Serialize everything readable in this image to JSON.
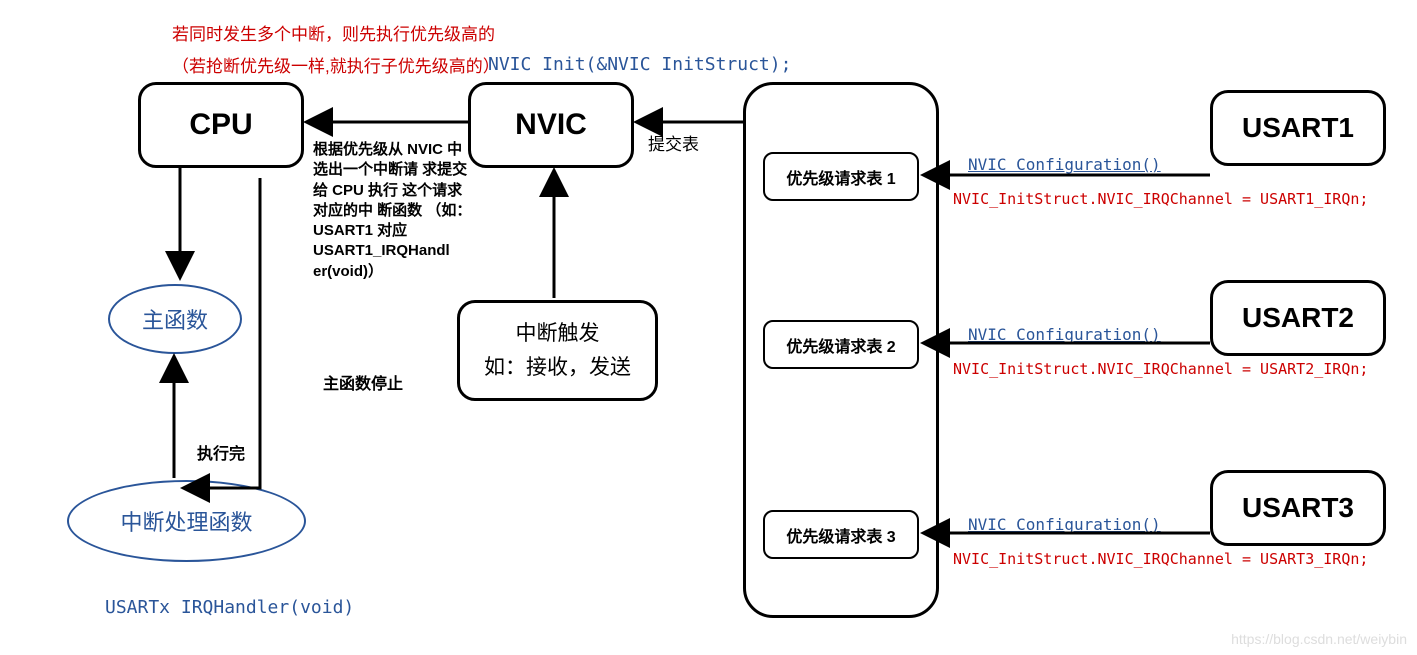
{
  "notes": {
    "top1": "若同时发生多个中断，则先执行优先级高的",
    "top2": "（若抢断优先级一样,就执行子优先级高的）",
    "nvic_init": "NVIC Init(&NVIC InitStruct);",
    "cpu_to_main_note": "根据优先级从 NVIC\n中选出一个中断请\n求提交给 CPU 执行\n这个请求对应的中\n断函数\n（如：USART1 对应\nUSART1_IRQHandl\ner(void)）",
    "main_stop": "主函数停止",
    "exec_done": "执行完",
    "submit": "提交表",
    "irq_handler": "USARTx IRQHandler(void)"
  },
  "boxes": {
    "cpu": "CPU",
    "nvic": "NVIC",
    "trigger_l1": "中断触发",
    "trigger_l2": "如：接收，发送",
    "req1": "优先级请求表 1",
    "req2": "优先级请求表 2",
    "req3": "优先级请求表 3",
    "usart1": "USART1",
    "usart2": "USART2",
    "usart3": "USART3"
  },
  "ellipses": {
    "main": "主函数",
    "handler": "中断处理函数"
  },
  "usart_lines": {
    "conf": "NVIC Configuration()",
    "assign1": "NVIC_InitStruct.NVIC_IRQChannel = USART1_IRQn;",
    "assign2": "NVIC_InitStruct.NVIC_IRQChannel = USART2_IRQn;",
    "assign3": "NVIC_InitStruct.NVIC_IRQChannel = USART3_IRQn;"
  },
  "watermark": "https://blog.csdn.net/weiybin"
}
